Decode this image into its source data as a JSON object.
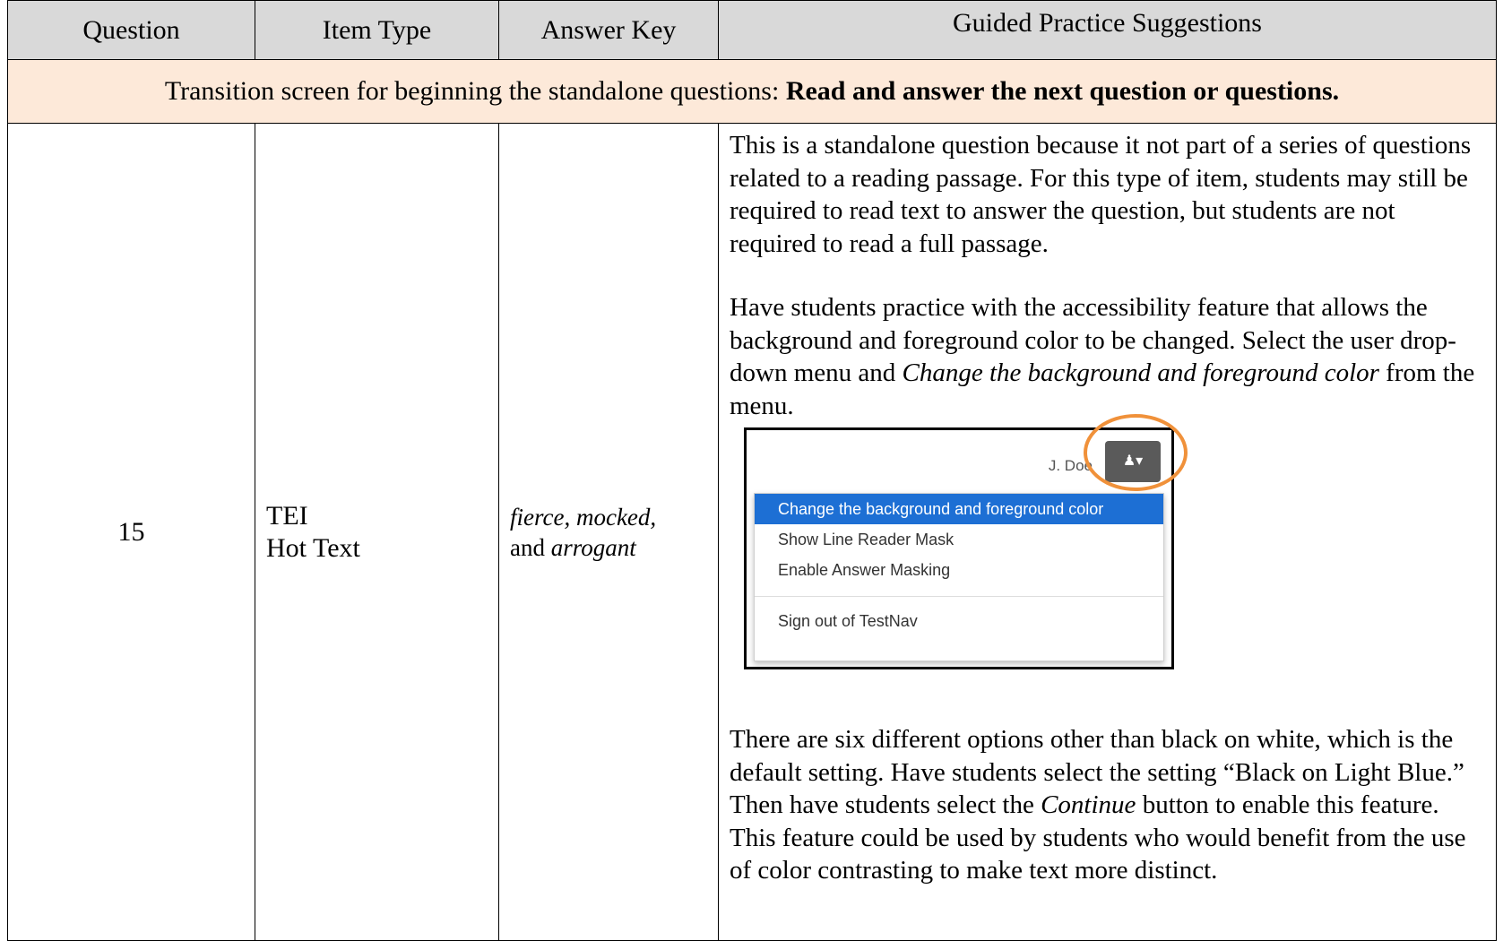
{
  "header": {
    "question": "Question",
    "item_type": "Item Type",
    "answer_key": "Answer Key",
    "guided": "Guided Practice Suggestions"
  },
  "transition": {
    "prefix": "Transition screen for beginning the standalone questions: ",
    "bold": "Read and answer the next question or questions."
  },
  "row": {
    "question": "15",
    "item_type_line1": "TEI",
    "item_type_line2": "Hot Text",
    "answer_key": {
      "italic1": "fierce, mocked,",
      "plain": "and ",
      "italic2": "arrogant"
    },
    "guidance": {
      "p1": "This is a standalone question because it not part of a series of questions related to a reading passage. For this type of item, students may still be required to read text to answer the question, but students are not required to read a full passage.",
      "p2_a": "Have students practice with the accessibility feature that allows the background and foreground color to be changed. Select the user drop-down menu and ",
      "p2_italic": "Change the background and foreground color",
      "p2_b": " from the menu.",
      "p3_a": "There are six different options other than black on white, which is the default setting.  Have students select the setting “Black on Light Blue.”  Then have students select the ",
      "p3_italic": "Continue",
      "p3_b": " button to enable this feature. This feature could be used by students who would benefit from the use of color contrasting to make text more distinct."
    },
    "screenshot": {
      "user_name": "J. Doe",
      "user_icon": "user-icon",
      "menu": [
        "Change the background and foreground color",
        "Show Line Reader Mask",
        "Enable Answer Masking",
        "Sign out of TestNav"
      ],
      "highlight_color": "#f0913a",
      "selected_color": "#1d6fd4"
    }
  }
}
